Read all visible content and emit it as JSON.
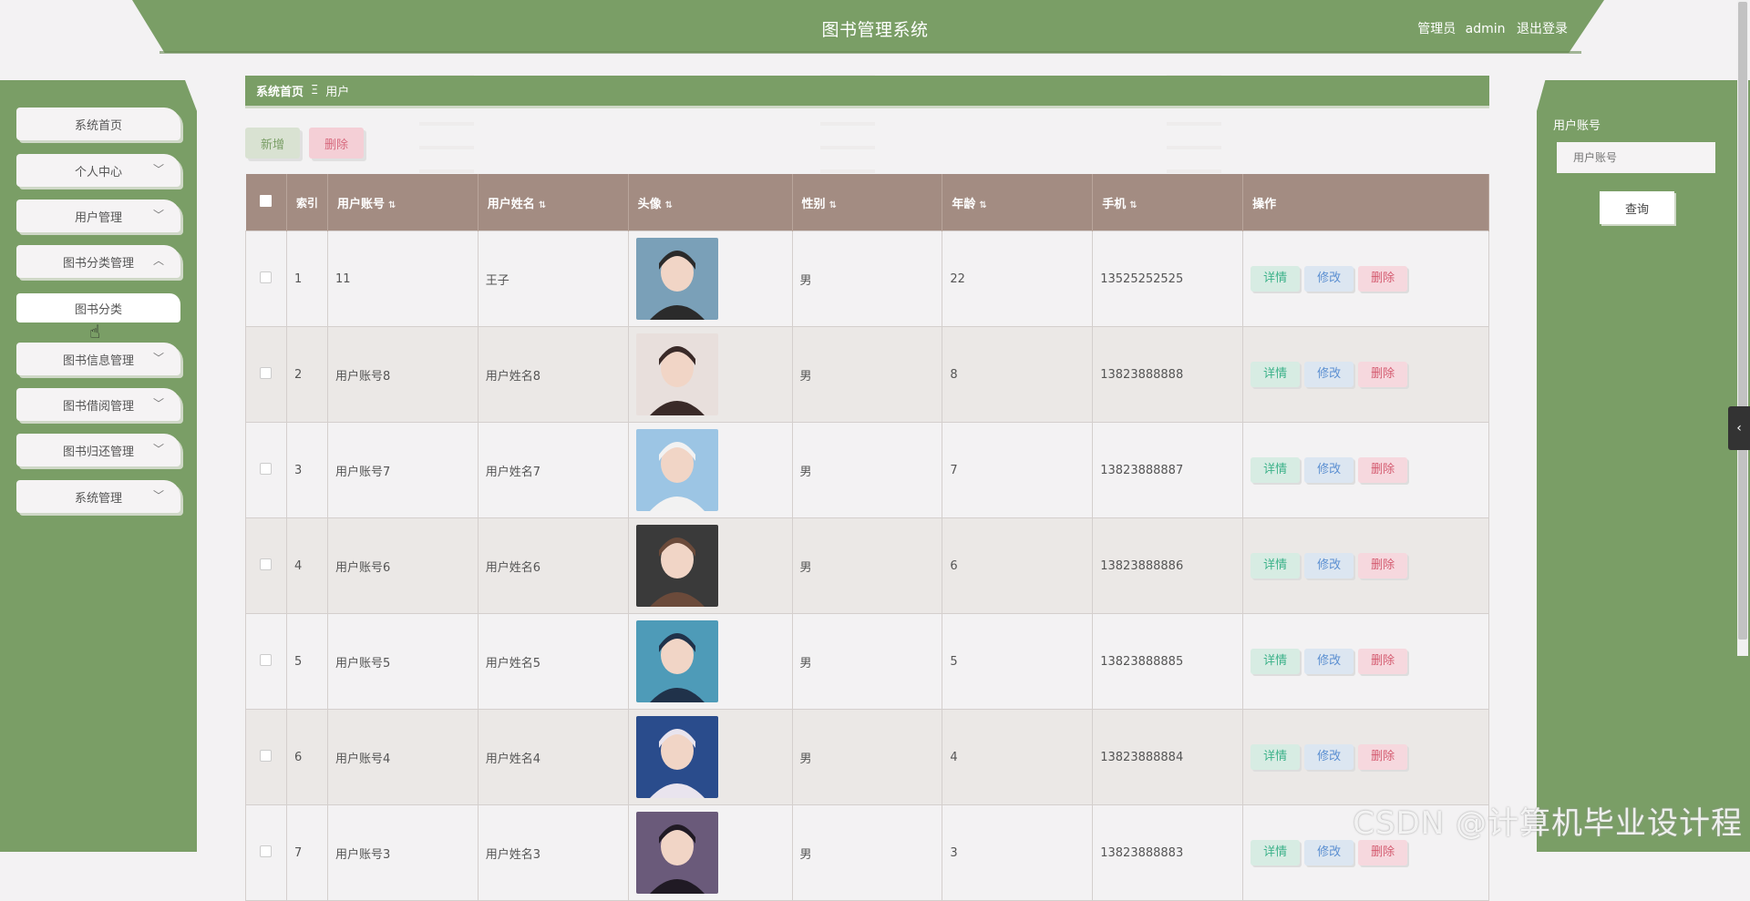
{
  "header": {
    "title": "图书管理系统",
    "role": "管理员",
    "username": "admin",
    "logout": "退出登录"
  },
  "sidebar": {
    "items": [
      {
        "label": "系统首页"
      },
      {
        "label": "个人中心"
      },
      {
        "label": "用户管理"
      },
      {
        "label": "图书分类管理"
      },
      {
        "label": "图书分类"
      },
      {
        "label": "图书信息管理"
      },
      {
        "label": "图书借阅管理"
      },
      {
        "label": "图书归还管理"
      },
      {
        "label": "系统管理"
      }
    ]
  },
  "breadcrumb": {
    "home": "系统首页",
    "separator": "Ξ",
    "current": "用户"
  },
  "toolbar": {
    "add_label": "新增",
    "delete_label": "删除"
  },
  "table": {
    "columns": [
      "索引",
      "用户账号",
      "用户姓名",
      "头像",
      "性别",
      "年龄",
      "手机",
      "操作"
    ],
    "rows": [
      {
        "index": "1",
        "account": "11",
        "name": "王子",
        "gender": "男",
        "age": "22",
        "phone": "13525252525"
      },
      {
        "index": "2",
        "account": "用户账号8",
        "name": "用户姓名8",
        "gender": "男",
        "age": "8",
        "phone": "13823888888"
      },
      {
        "index": "3",
        "account": "用户账号7",
        "name": "用户姓名7",
        "gender": "男",
        "age": "7",
        "phone": "13823888887"
      },
      {
        "index": "4",
        "account": "用户账号6",
        "name": "用户姓名6",
        "gender": "男",
        "age": "6",
        "phone": "13823888886"
      },
      {
        "index": "5",
        "account": "用户账号5",
        "name": "用户姓名5",
        "gender": "男",
        "age": "5",
        "phone": "13823888885"
      },
      {
        "index": "6",
        "account": "用户账号4",
        "name": "用户姓名4",
        "gender": "男",
        "age": "4",
        "phone": "13823888884"
      },
      {
        "index": "7",
        "account": "用户账号3",
        "name": "用户姓名3",
        "gender": "男",
        "age": "3",
        "phone": "13823888883"
      }
    ],
    "actions": {
      "detail": "详情",
      "edit": "修改",
      "remove": "删除"
    }
  },
  "search": {
    "label": "用户账号",
    "placeholder": "用户账号",
    "button": "查询"
  },
  "watermark": "CSDN @计算机毕业设计程",
  "colors": {
    "primary": "#7a9e66",
    "table_header": "#a38c82"
  }
}
